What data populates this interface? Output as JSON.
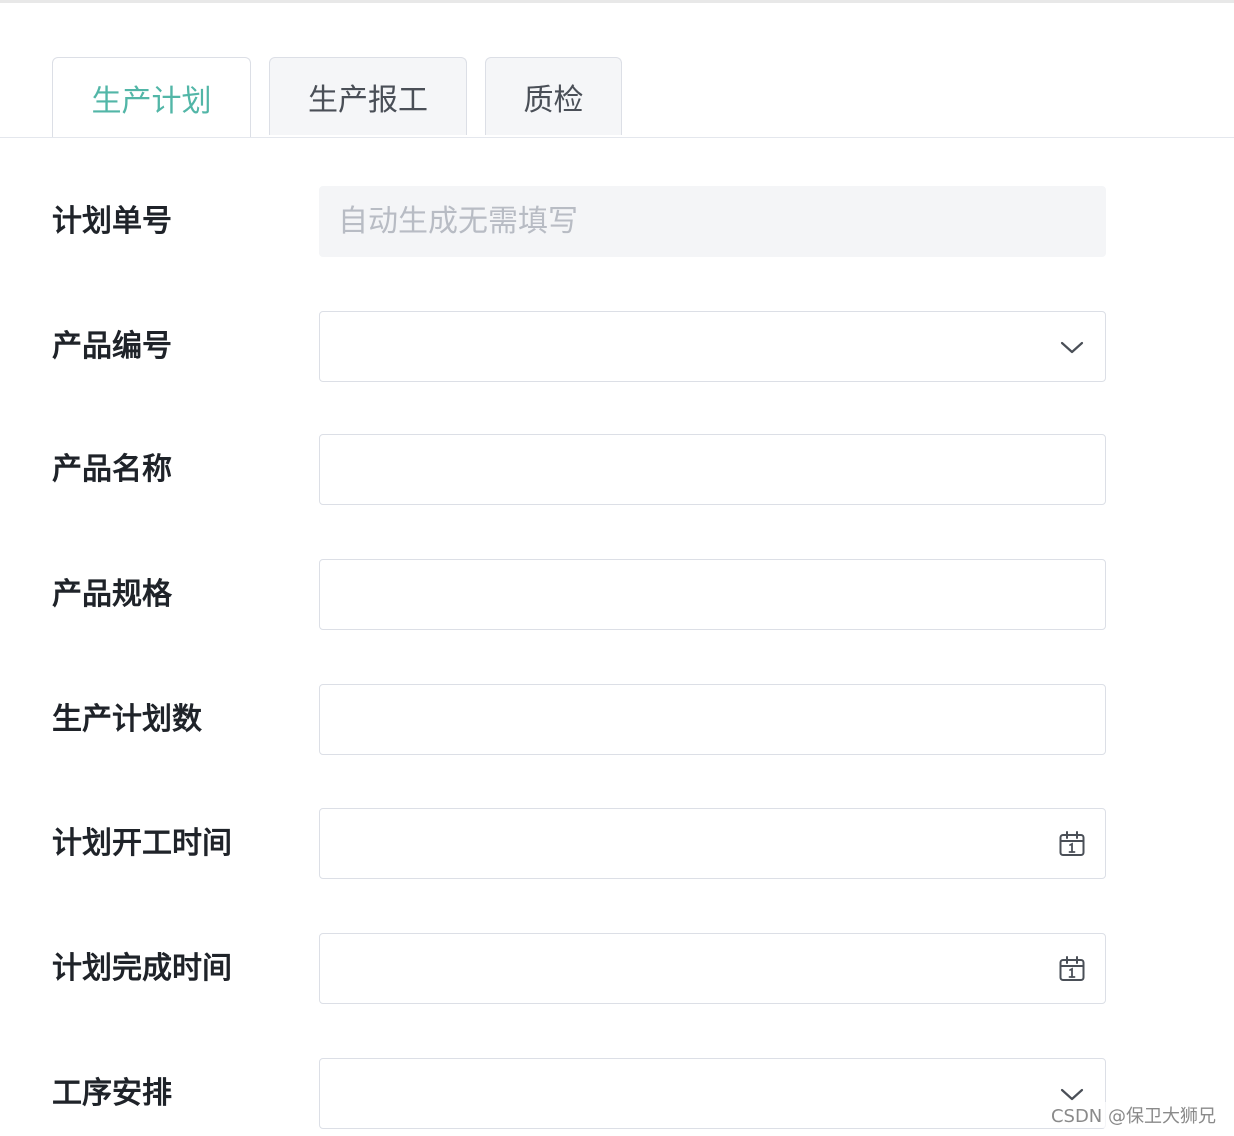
{
  "tabs": [
    {
      "label": "生产计划",
      "active": true
    },
    {
      "label": "生产报工",
      "active": false
    },
    {
      "label": "质检",
      "active": false
    }
  ],
  "form": {
    "fields": [
      {
        "label": "计划单号",
        "type": "text",
        "placeholder": "自动生成无需填写",
        "value": "",
        "disabled": true
      },
      {
        "label": "产品编号",
        "type": "select",
        "placeholder": "",
        "value": "",
        "icon": "chevron-down-icon"
      },
      {
        "label": "产品名称",
        "type": "text",
        "placeholder": "",
        "value": ""
      },
      {
        "label": "产品规格",
        "type": "text",
        "placeholder": "",
        "value": ""
      },
      {
        "label": "生产计划数",
        "type": "text",
        "placeholder": "",
        "value": ""
      },
      {
        "label": "计划开工时间",
        "type": "date",
        "placeholder": "",
        "value": "",
        "icon": "calendar-icon"
      },
      {
        "label": "计划完成时间",
        "type": "date",
        "placeholder": "",
        "value": "",
        "icon": "calendar-icon"
      },
      {
        "label": "工序安排",
        "type": "select",
        "placeholder": "",
        "value": "",
        "icon": "chevron-down-icon"
      }
    ]
  },
  "colors": {
    "accent": "#52b6a7",
    "label_text": "#1f2329",
    "placeholder": "#b8bcc4",
    "border": "#dcdfe6",
    "disabled_bg": "#f4f5f7"
  },
  "watermark": "CSDN @保卫大狮兄"
}
